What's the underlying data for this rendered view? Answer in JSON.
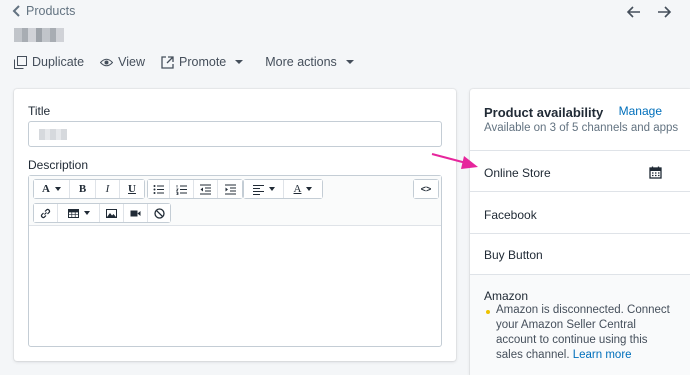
{
  "breadcrumb": {
    "label": "Products"
  },
  "actions": {
    "duplicate": "Duplicate",
    "view": "View",
    "promote": "Promote",
    "more": "More actions"
  },
  "form": {
    "title_label": "Title",
    "description_label": "Description",
    "toolbar": {
      "font": "A",
      "bold": "B",
      "italic": "I",
      "underline": "U",
      "color": "A",
      "source": "<>"
    }
  },
  "availability": {
    "heading": "Product availability",
    "manage": "Manage",
    "summary": "Available on 3 of 5 channels and apps",
    "channels": [
      "Online Store",
      "Facebook",
      "Buy Button"
    ],
    "amazon": {
      "name": "Amazon",
      "message": "Amazon is disconnected. Connect your Amazon Seller Central account to continue using this sales channel.",
      "link": "Learn more"
    }
  },
  "colors": {
    "accent": "#006fbb",
    "annotation": "#e6259c",
    "warning": "#eec200"
  }
}
